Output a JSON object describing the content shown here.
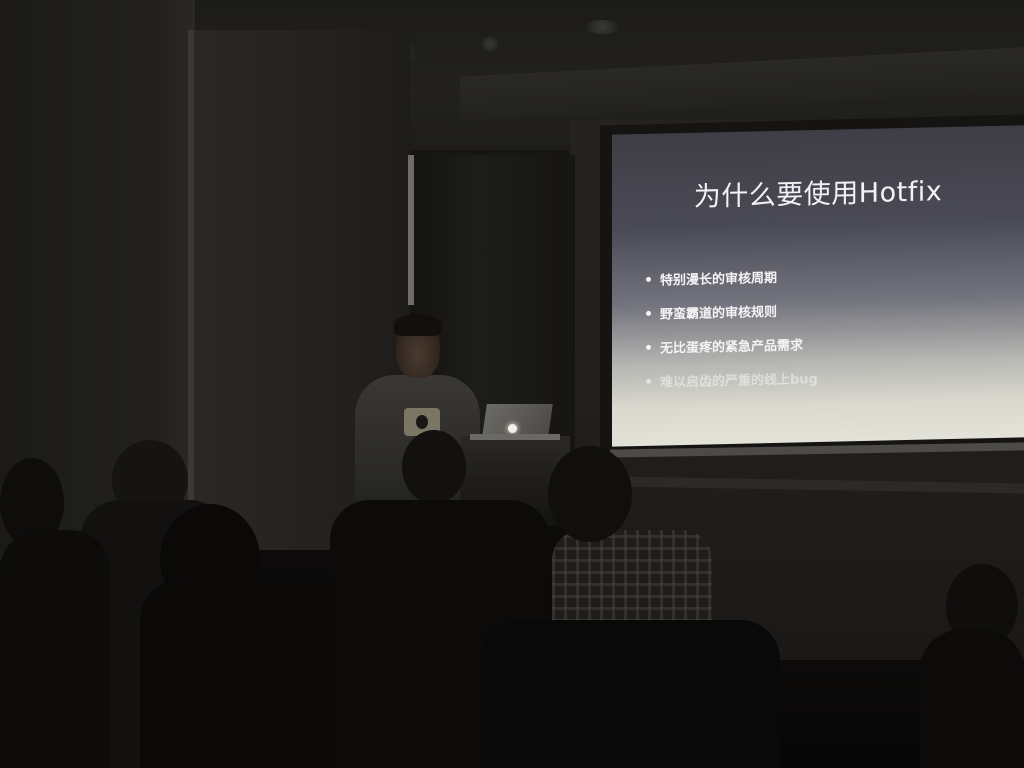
{
  "slide": {
    "title": "为什么要使用Hotfix",
    "bullets": [
      "特别漫长的审核周期",
      "野蛮霸道的审核规则",
      "无比蛋疼的紧急产品需求",
      "难以启齿的严重的线上bug"
    ]
  },
  "colors": {
    "room_dark": "#0b0a09",
    "screen_top": "#3f3e46",
    "screen_bottom": "#e2e2d8",
    "slide_text": "#f2f2f4"
  }
}
